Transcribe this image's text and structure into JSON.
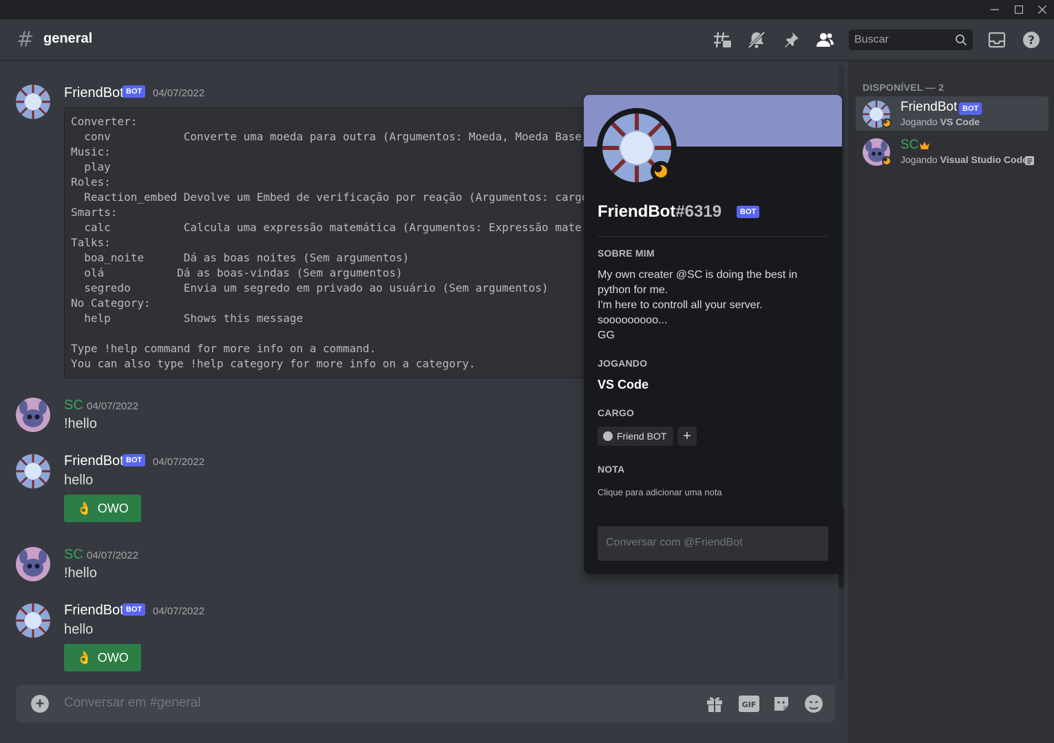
{
  "window": {
    "controls": [
      "minimize",
      "maximize",
      "close"
    ]
  },
  "header": {
    "channel_name": "general",
    "search_placeholder": "Buscar"
  },
  "colors": {
    "background": "#36393f",
    "sidebar": "#2f3136",
    "popout": "#18191c",
    "blurple": "#5865f2",
    "green_button": "#2d7d46",
    "sc_name": "#3ba55c",
    "idle": "#faa61a",
    "banner": "#8891c7"
  },
  "messages": [
    {
      "author": "FriendBot",
      "bot_tag": "BOT",
      "timestamp": "04/07/2022",
      "code_lines": [
        "Converter:",
        "  conv           Converte uma moeda para outra (Argumentos: Moeda, Moeda Base)",
        "Music:",
        "  play",
        "Roles:",
        "  Reaction_embed Devolve um Embed de verificação por reação (Argumentos: cargo",
        "Smarts:",
        "  calc           Calcula uma expressão matemática (Argumentos: Expressão mate.",
        "Talks:",
        "  boa_noite      Dá as boas noites (Sem argumentos)",
        "  olá           Dá as boas-vindas (Sem argumentos)",
        "  segredo        Envia um segredo em privado ao usuário (Sem argumentos)",
        "No Category:",
        "  help           Shows this message",
        "",
        "Type !help command for more info on a command.",
        "You can also type !help category for more info on a category."
      ]
    },
    {
      "author": "SC",
      "timestamp": "04/07/2022",
      "text": "!hello"
    },
    {
      "author": "FriendBot",
      "bot_tag": "BOT",
      "timestamp": "04/07/2022",
      "text": "hello",
      "button": {
        "emoji": "👌",
        "label": "OWO"
      }
    },
    {
      "author": "SC",
      "timestamp": "04/07/2022",
      "text": "!hello"
    },
    {
      "author": "FriendBot",
      "bot_tag": "BOT",
      "timestamp": "04/07/2022",
      "text": "hello",
      "button": {
        "emoji": "👌",
        "label": "OWO"
      }
    }
  ],
  "composer": {
    "placeholder": "Conversar em #general",
    "icons": [
      "gift-icon",
      "gif-icon",
      "sticker-icon",
      "emoji-icon"
    ],
    "gif_label": "GIF"
  },
  "members": {
    "heading": "DISPONÍVEL — 2",
    "list": [
      {
        "name": "FriendBot",
        "bot_tag": "BOT",
        "activity_prefix": "Jogando ",
        "activity": "VS Code",
        "active": true
      },
      {
        "name": "SC",
        "crown": true,
        "activity_prefix": "Jogando ",
        "activity": "Visual Studio Code"
      }
    ]
  },
  "profile": {
    "username": "FriendBot",
    "discriminator": "#6319",
    "bot_tag": "BOT",
    "about_title": "SOBRE MIM",
    "about_lines": [
      "My own creater @SC is doing the best in",
      "python for me.",
      "I'm here to controll all your server.",
      "sooooooooo...",
      "GG"
    ],
    "playing_title": "JOGANDO",
    "playing": "VS Code",
    "role_title": "CARGO",
    "role": "Friend BOT",
    "role_add": "+",
    "note_title": "NOTA",
    "note_placeholder": "Clique para adicionar uma nota",
    "message_placeholder": "Conversar com @FriendBot"
  }
}
